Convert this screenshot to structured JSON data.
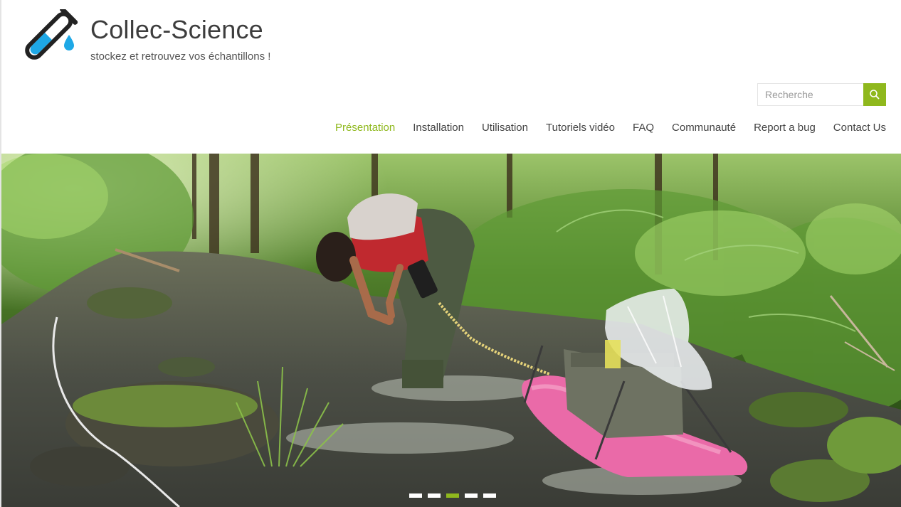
{
  "site": {
    "title": "Collec-Science",
    "tagline": "stockez et retrouvez vos échantillons !",
    "brand_color": "#8fb81d",
    "logo_icon": "test-tube-icon"
  },
  "search": {
    "placeholder": "Recherche",
    "button_icon": "search-icon"
  },
  "nav": {
    "items": [
      {
        "label": "Présentation",
        "active": true
      },
      {
        "label": "Installation"
      },
      {
        "label": "Utilisation"
      },
      {
        "label": "Tutoriels vidéo"
      },
      {
        "label": "FAQ"
      },
      {
        "label": "Communauté"
      },
      {
        "label": "Report a bug"
      },
      {
        "label": "Contact Us"
      }
    ]
  },
  "slider": {
    "slide_count": 5,
    "active_slide": 3,
    "image": "field-sampling-stream-photo"
  }
}
